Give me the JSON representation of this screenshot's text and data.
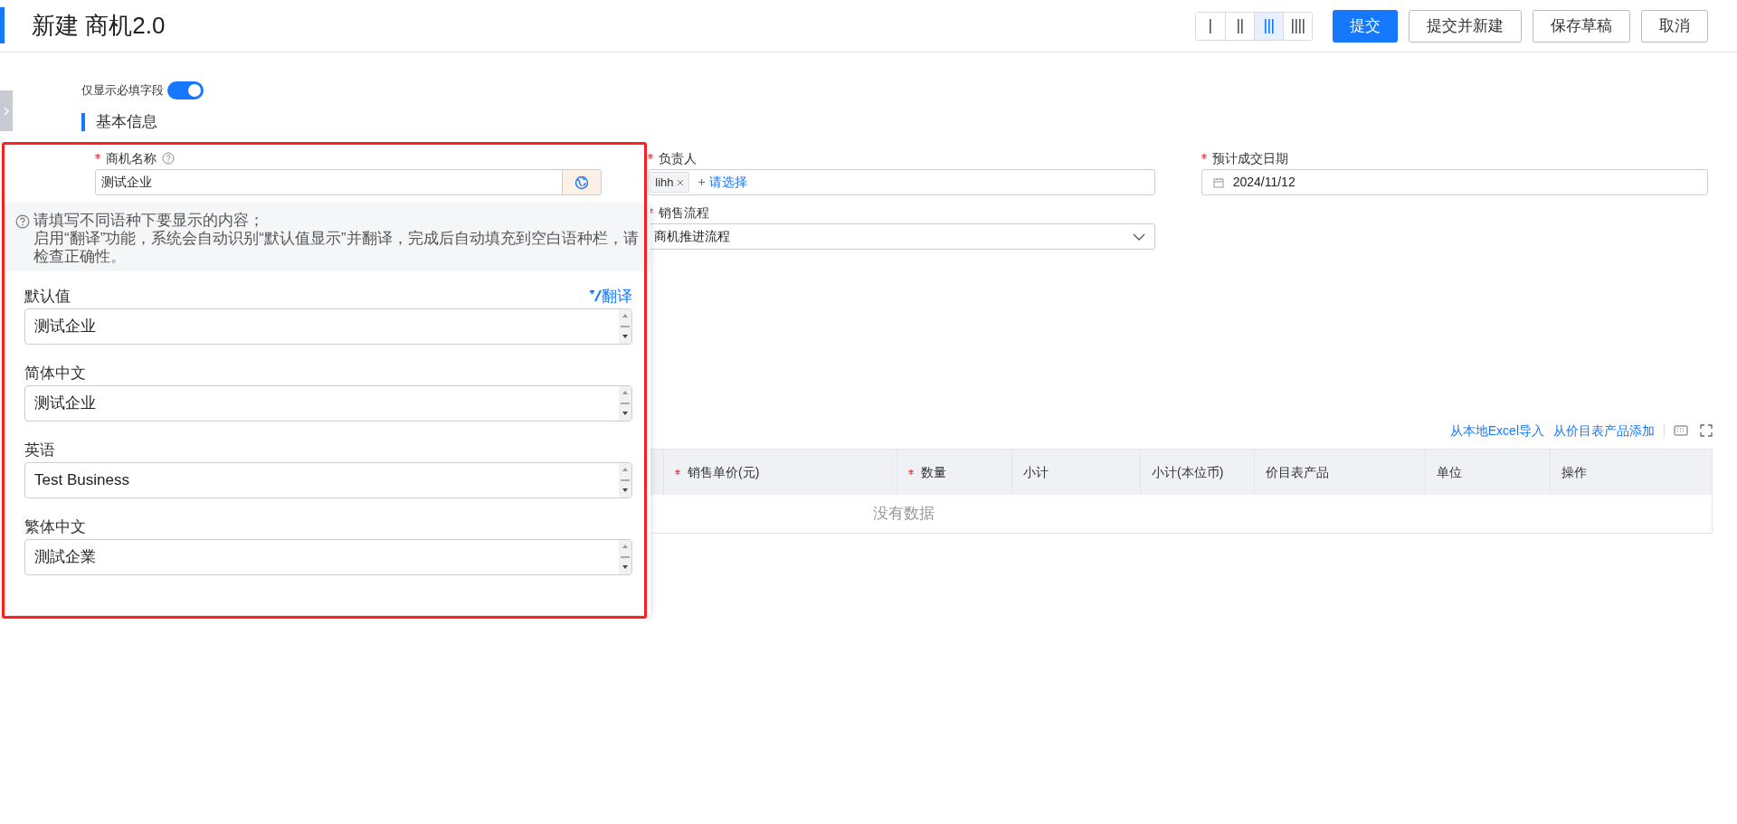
{
  "header": {
    "title": "新建 商机2.0",
    "layout_options": [
      {
        "kind": "one",
        "selected": false
      },
      {
        "kind": "two",
        "selected": false
      },
      {
        "kind": "three",
        "selected": true
      },
      {
        "kind": "four",
        "selected": false
      }
    ],
    "actions": [
      {
        "label": "提交",
        "primary": true
      },
      {
        "label": "提交并新建",
        "primary": false
      },
      {
        "label": "保存草稿",
        "primary": false
      },
      {
        "label": "取消",
        "primary": false
      }
    ]
  },
  "required_only": {
    "label": "仅显示必填字段",
    "on": true
  },
  "section": {
    "title": "基本信息"
  },
  "fields": [
    {
      "kind": "text",
      "label": "商机名称",
      "required": true,
      "help": true,
      "value": "测试企业"
    },
    {
      "kind": "people",
      "label": "负责人",
      "required": true,
      "tags": [
        "lihh"
      ],
      "add_label": "+ 请选择"
    },
    {
      "kind": "date",
      "label": "预计成交日期",
      "required": true,
      "value": "2024/11/12"
    },
    {
      "kind": "blank"
    },
    {
      "kind": "select",
      "label": "销售流程",
      "required": true,
      "value": "商机推进流程"
    }
  ],
  "translation_popup": {
    "notice": [
      "请填写不同语种下要显示的内容；",
      "启用“翻译”功能，系统会自动识别“默认值显示”并翻译，完成后自动填充到空白语种栏，请检查正确性。"
    ],
    "translate_label": "翻译",
    "languages": [
      {
        "label": "默认值",
        "value": "测试企业"
      },
      {
        "label": "简体中文",
        "value": "测试企业"
      },
      {
        "label": "英语",
        "value": "Test Business"
      },
      {
        "label": "繁体中文",
        "value": "測試企業"
      }
    ]
  },
  "products_table": {
    "actions": [
      "从本地Excel导入",
      "从价目表产品添加"
    ],
    "columns": [
      {
        "label": "销售单价(元)",
        "required": true
      },
      {
        "label": "数量",
        "required": true
      },
      {
        "label": "小计",
        "required": false
      },
      {
        "label": "小计(本位币)",
        "required": false
      },
      {
        "label": "价目表产品",
        "required": false
      },
      {
        "label": "单位",
        "required": false
      },
      {
        "label": "操作",
        "required": false
      }
    ],
    "empty_text": "没有数据"
  }
}
